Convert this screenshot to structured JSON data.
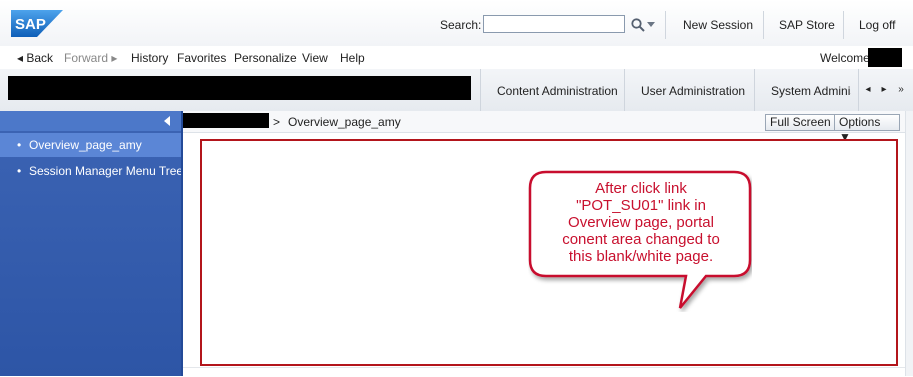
{
  "header": {
    "logo_text": "SAP",
    "search_label": "Search:",
    "search_value": "",
    "links": [
      "New Session",
      "SAP Store",
      "Log off"
    ]
  },
  "nav": {
    "back": "Back",
    "forward": "Forward",
    "items": [
      "History",
      "Favorites",
      "Personalize",
      "View",
      "Help"
    ],
    "welcome": "Welcome:"
  },
  "tabs": {
    "items": [
      "Content Administration",
      "User Administration",
      "System Administ"
    ],
    "nav_prev": "◂",
    "nav_next": "▸",
    "nav_more": "»"
  },
  "sidebar": {
    "collapse_glyph": "◂",
    "items": [
      {
        "label": "Overview_page_amy",
        "selected": true
      },
      {
        "label": "Session Manager Menu Tree ...",
        "selected": false
      }
    ]
  },
  "content": {
    "breadcrumb_sep": ">",
    "breadcrumb": "Overview_page_amy",
    "full_screen": "Full Screen",
    "options": "Options ▼"
  },
  "callout": {
    "lines": [
      "After click link",
      "\"POT_SU01\" link in",
      "Overview page, portal",
      "conent area changed to",
      "this blank/white page."
    ]
  },
  "colors": {
    "sidebar_bg": "#2d55a6",
    "sidebar_selected": "#5b86d6",
    "accent_red": "#b3151b",
    "callout_text": "#c8102e",
    "logo_blue": "#1e6fc9"
  }
}
